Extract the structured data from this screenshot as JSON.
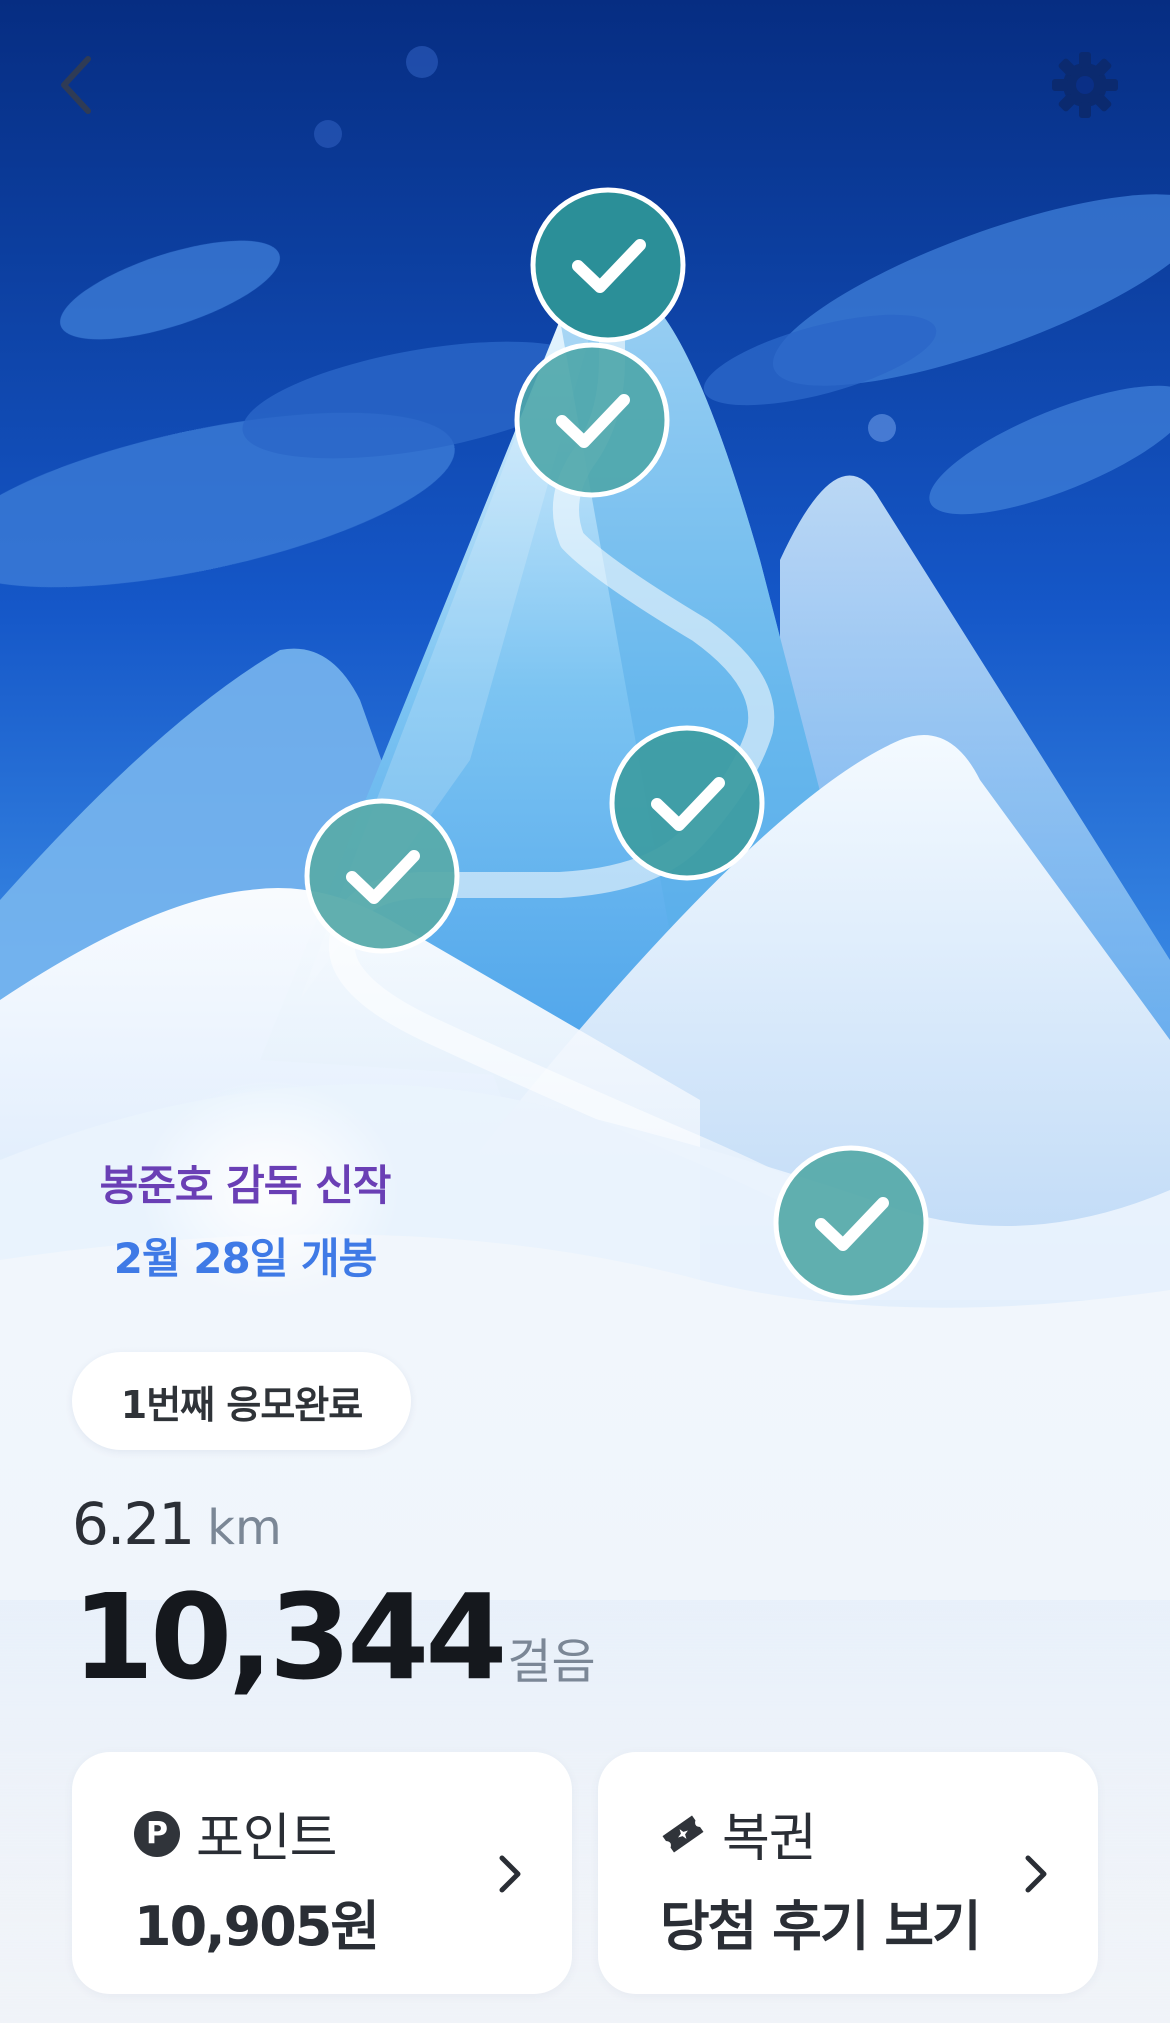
{
  "promo": {
    "line1": "봉준호 감독 신작",
    "line2": "2월 28일 개봉"
  },
  "entry_badge": "1번째 응모완료",
  "distance": {
    "value": "6.21",
    "unit": "km"
  },
  "steps": {
    "value": "10,344",
    "unit": "걸음"
  },
  "points_card": {
    "title": "포인트",
    "value": "10,905원"
  },
  "lottery_card": {
    "title": "복권",
    "value": "당첨 후기 보기"
  },
  "checkpoints": [
    {
      "name": "checkpoint-1",
      "completed": true
    },
    {
      "name": "checkpoint-2",
      "completed": true
    },
    {
      "name": "checkpoint-3",
      "completed": true
    },
    {
      "name": "checkpoint-4",
      "completed": true
    },
    {
      "name": "checkpoint-5",
      "completed": true
    }
  ],
  "icons": {
    "back": "chevron-left-icon",
    "settings": "gear-icon",
    "points": "p-coin-icon",
    "lottery": "ticket-icon",
    "checkpoint": "check-icon"
  },
  "colors": {
    "sky_top": "#0a2f86",
    "checkpoint_fill": "#4fa7a9",
    "promo_purple": "#6a3fb5",
    "promo_blue": "#3f7ae6"
  }
}
